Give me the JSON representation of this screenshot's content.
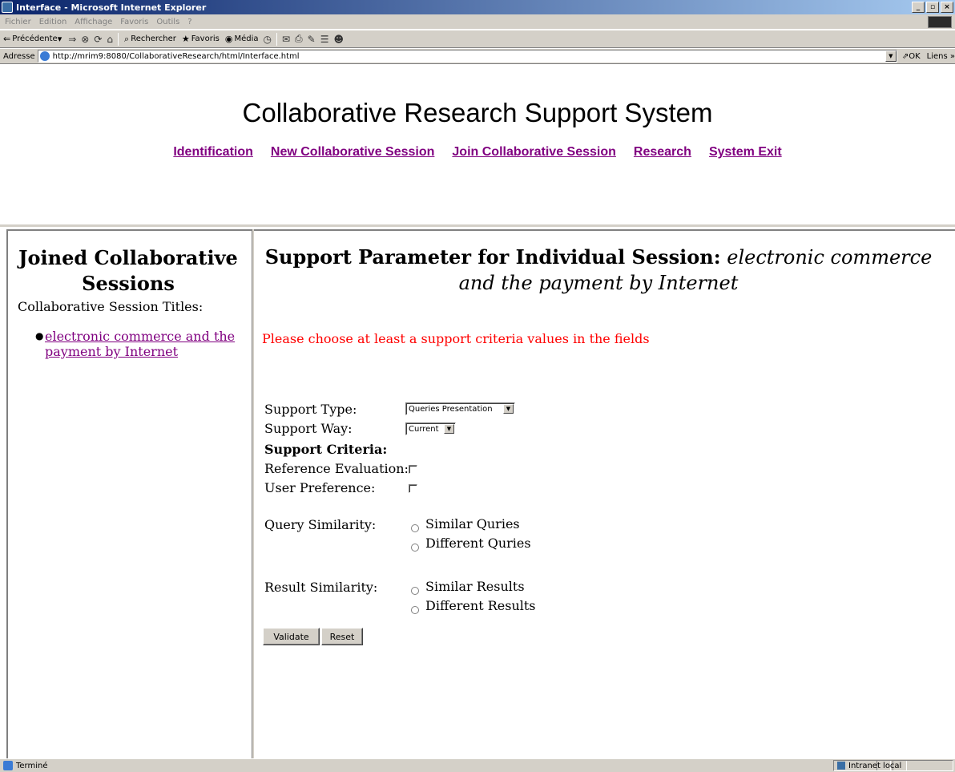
{
  "window": {
    "title": "Interface - Microsoft Internet Explorer",
    "buttons": [
      "_",
      "▫",
      "×"
    ]
  },
  "menubar": {
    "items": [
      "Fichier",
      "Edition",
      "Affichage",
      "Favoris",
      "Outils",
      "?"
    ]
  },
  "toolbar": {
    "back": "Précédente",
    "search": "Rechercher",
    "favorites": "Favoris",
    "media": "Média"
  },
  "addressbar": {
    "label": "Adresse",
    "url": "http://mrim9:8080/CollaborativeResearch/html/Interface.html",
    "go": "OK",
    "links": "Liens"
  },
  "header": {
    "title": "Collaborative Research Support System",
    "nav": [
      "Identification",
      "New Collaborative Session",
      "Join Collaborative Session",
      "Research",
      "System Exit"
    ]
  },
  "sidebar": {
    "heading_line1": "Joined Collaborative",
    "heading_line2": "Sessions",
    "subtitle": "Collaborative Session Titles:",
    "sessions": [
      "electronic commerce and the payment by Internet"
    ]
  },
  "main": {
    "heading_bold": "Support Parameter for Individual Session:",
    "heading_italic1": "electronic commerce",
    "heading_italic2": "and the payment by Internet",
    "warning": "Please choose at least a support criteria values in the fields",
    "support_type_label": "Support Type:",
    "support_type_value": "Queries Presentation",
    "support_way_label": "Support Way:",
    "support_way_value": "Current",
    "criteria_label": "Support Criteria:",
    "ref_eval_label": "Reference Evaluation:",
    "user_pref_label": "User Preference:",
    "query_sim_label": "Query Similarity:",
    "query_opt1": "Similar Quries",
    "query_opt2": "Different Quries",
    "result_sim_label": "Result Similarity:",
    "result_opt1": "Similar Results",
    "result_opt2": "Different Results",
    "validate": "Validate",
    "reset": "Reset"
  },
  "statusbar": {
    "status": "Terminé",
    "zone": "Intranet local"
  }
}
